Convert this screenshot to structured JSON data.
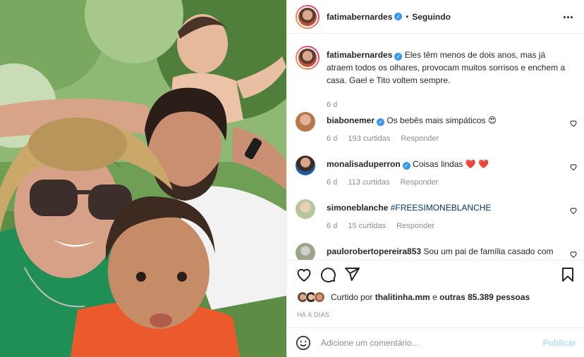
{
  "post": {
    "author": "fatimabernardes",
    "follow_status": "Seguindo",
    "caption": "Eles têm menos de dois anos, mas já atraem todos os olhares, provocam muitos sorrisos e enchem a casa. Gael e Tito voltem sempre.",
    "caption_time": "6 d"
  },
  "comments": [
    {
      "user": "biabonemer",
      "verified": true,
      "text": "Os bebês mais simpáticos 😍",
      "time": "6 d",
      "likes": "193 curtidas",
      "reply": "Responder"
    },
    {
      "user": "monalisaduperron",
      "verified": true,
      "text": "Coisas lindas ❤️ ❤️",
      "time": "6 d",
      "likes": "113 curtidas",
      "reply": "Responder"
    },
    {
      "user": "simoneblanche",
      "verified": false,
      "text": "#FREESIMONEBLANCHE",
      "time": "6 d",
      "likes": "15 curtidas",
      "reply": "Responder"
    },
    {
      "user": "pauloroberto pereira853",
      "verified": false,
      "text": "Sou um pai de família casado com",
      "time": "",
      "likes": "",
      "reply": ""
    }
  ],
  "likes": {
    "prefix": "Curtido por",
    "user": "thalitinha.mm",
    "middle": "e",
    "others": "outras 85.389 pessoas"
  },
  "posted_ago": "HÁ 6 DIAS",
  "add_comment": {
    "placeholder": "Adicione um comentário...",
    "publish": "Publicar"
  },
  "icons": {
    "like": "heart-icon",
    "comment": "comment-icon",
    "share": "share-icon",
    "save": "bookmark-icon",
    "options": "more-options-icon",
    "emoji": "emoji-icon"
  },
  "colors": {
    "verified": "#3897f0",
    "link": "#00376b",
    "muted": "#8e8e8e",
    "publish_disabled": "#b2dffc",
    "heart_emoji": "#ed4956"
  }
}
